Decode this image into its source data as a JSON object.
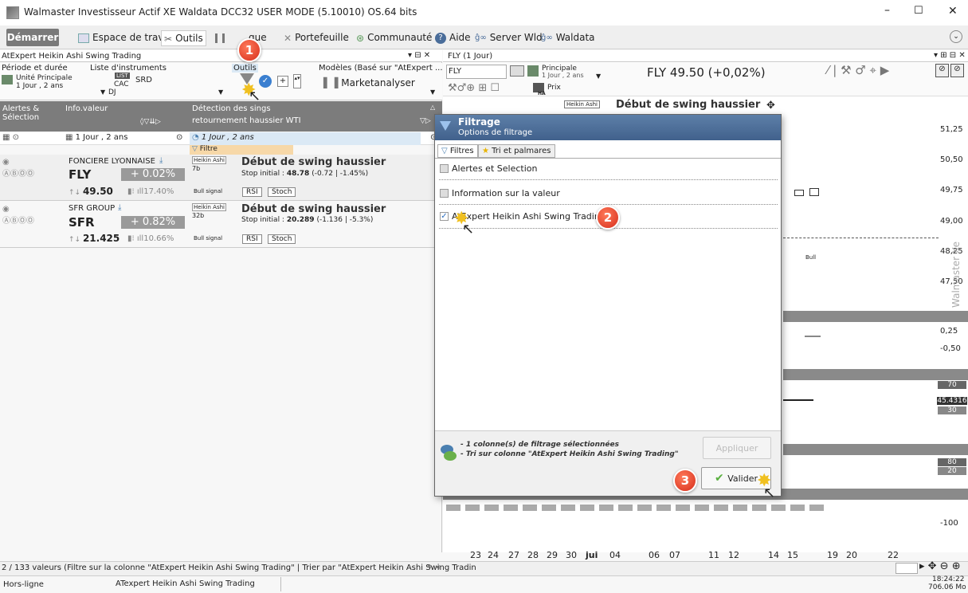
{
  "window": {
    "title": "Walmaster Investisseur Actif XE Waldata DCC32 USER MODE (5.10010) OS.64 bits",
    "min": "–",
    "max": "☐",
    "close": "✕"
  },
  "menu": {
    "demarrer": "Démarrer",
    "items": [
      "Espace de travail",
      "Outils",
      "",
      "que",
      "Portefeuille",
      "Communauté",
      "Aide",
      "Server Wld",
      "Waldata"
    ]
  },
  "left_panel": {
    "title": "AtExpert Heikin Ashi Swing Trading",
    "period_label": "Période et durée",
    "period_unit": "Unité Principale",
    "period_value": "1 Jour , 2 ans",
    "list_label": "Liste d'instruments",
    "list_list": "LIST",
    "list_cac": "CAC",
    "list_srd": "SRD",
    "list_dj": "DJ",
    "tools_label": "Outils",
    "models_label": "Modèles (Basé sur \"AtExpert ...",
    "marketanalyser": "Marketanalyser",
    "col1": "Alertes &",
    "col1b": "Sélection",
    "col2": "Info.valeur",
    "col3": "Détection des s",
    "col3b": "ings",
    "col3c": "retournement haussier WTI",
    "period_row": "1 Jour , 2 ans",
    "period_row2": "1 Jour , 2 ans",
    "filtre": "Filtre",
    "rows": [
      {
        "name": "FONCIERE LYONNAISE",
        "ticker": "FLY",
        "change": "+ 0.02%",
        "price": "49.50",
        "vol": "17.40%",
        "tag": "Heikin Ashi",
        "bars": "7b",
        "signal": "Début de swing haussier",
        "stop": "Stop initial :",
        "stop_val": "48.78",
        "stop_delta": "(-0.72 | -1.45%)",
        "bull": "Bull signal",
        "rsi": "RSI",
        "stoch": "Stoch"
      },
      {
        "name": "SFR GROUP",
        "ticker": "SFR",
        "change": "+ 0.82%",
        "price": "21.425",
        "vol": "10.66%",
        "tag": "Heikin Ashi",
        "bars": "32b",
        "signal": "Début de swing haussier",
        "stop": "Stop initial :",
        "stop_val": "20.289",
        "stop_delta": "(-1.136 | -5.3%)",
        "bull": "Bull signal",
        "rsi": "RSI",
        "stoch": "Stoch"
      }
    ]
  },
  "chart": {
    "tab_title": "FLY (1 Jour)",
    "symbol": "FLY",
    "principale": "Principale",
    "principale_sub": "1 Jour , 2 ans",
    "quote": "FLY 49.50 (+0,02%)",
    "prix": "Prix",
    "ha": "HA",
    "heikin": "Heikin Ashi",
    "heading": "Début de swing haussier",
    "y_labels": [
      "51,25",
      "50,50",
      "49,75",
      "49,00",
      "48,25",
      "47,50"
    ],
    "ind1": [
      "0,25",
      "-0,50"
    ],
    "ind2_top": "70",
    "ind2_val": "45.4316",
    "ind2_bot": "30",
    "ind3_top": "80",
    "ind3_bot": "20",
    "ind4": "-100",
    "x_labels": [
      "23",
      "24",
      "27",
      "28",
      "29",
      "30",
      "jui",
      "04",
      "06",
      "07",
      "11",
      "12",
      "14",
      "15",
      "19",
      "20",
      "22"
    ],
    "watermark": "Walmaster Xe",
    "bull": "Bull"
  },
  "dialog": {
    "title": "Filtrage",
    "subtitle": "Options de filtrage",
    "tab1": "Filtres",
    "tab2": "Tri et palmares",
    "opt1": "Alertes et Selection",
    "opt2": "Information sur la valeur",
    "opt3": "AtExpert Heikin Ashi Swing Trading",
    "info1": "- 1 colonne(s) de filtrage sélectionnées",
    "info2": "- Tri sur colonne \"AtExpert Heikin Ashi Swing Trading\"",
    "apply": "Appliquer",
    "validate": "Valider"
  },
  "badges": {
    "b1": "1",
    "b2": "2",
    "b3": "3"
  },
  "status": {
    "line": "2 / 133 valeurs (Filtre sur la colonne \"AtExpert Heikin Ashi Swing Trading\" | Trier par \"AtExpert Heikin Ashi Swing Tradin",
    "offline": "Hors-ligne",
    "current": "ATexpert Heikin Ashi Swing Trading",
    "time": "18:24:22",
    "mem": "706.06 Mo"
  }
}
